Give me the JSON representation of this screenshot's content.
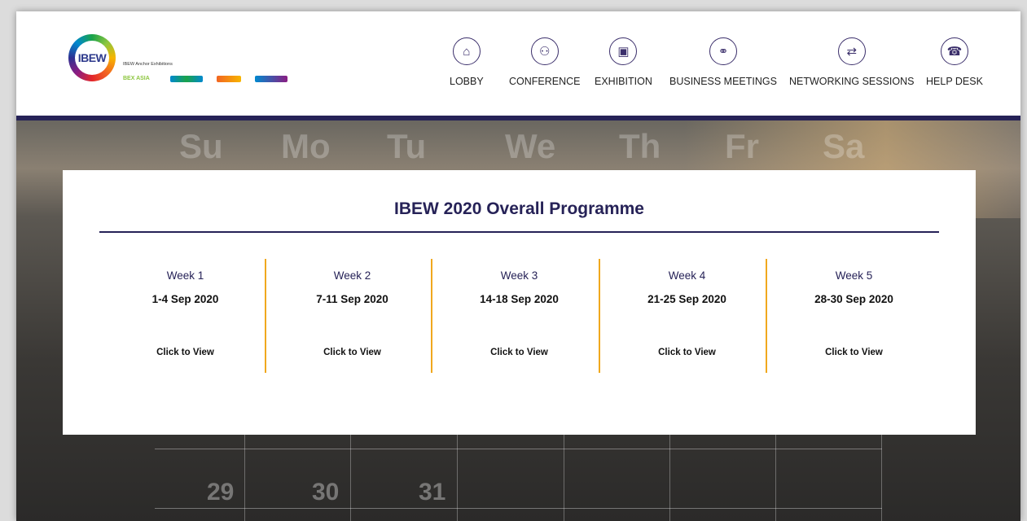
{
  "header": {
    "logo_text": "IBEW",
    "anchor_label": "IBEW Anchor Exhibitions",
    "partner_bex": "BEX ASIA"
  },
  "nav": [
    {
      "label": "LOBBY",
      "icon": "home-icon"
    },
    {
      "label": "CONFERENCE",
      "icon": "conference-icon"
    },
    {
      "label": "EXHIBITION",
      "icon": "exhibition-icon"
    },
    {
      "label": "BUSINESS MEETINGS",
      "icon": "business-meetings-icon"
    },
    {
      "label": "NETWORKING SESSIONS",
      "icon": "networking-icon"
    },
    {
      "label": "HELP DESK",
      "icon": "help-desk-icon"
    }
  ],
  "background": {
    "days": [
      "Su",
      "Mo",
      "Tu",
      "We",
      "Th",
      "Fr",
      "Sa"
    ],
    "dates": [
      "29",
      "30",
      "31"
    ]
  },
  "programme": {
    "title": "IBEW 2020 Overall Programme",
    "weeks": [
      {
        "name": "Week 1",
        "dates": "1-4 Sep 2020",
        "link": "Click to View"
      },
      {
        "name": "Week 2",
        "dates": "7-11 Sep 2020",
        "link": "Click to View"
      },
      {
        "name": "Week 3",
        "dates": "14-18 Sep 2020",
        "link": "Click to View"
      },
      {
        "name": "Week 4",
        "dates": "21-25 Sep 2020",
        "link": "Click to View"
      },
      {
        "name": "Week 5",
        "dates": "28-30 Sep 2020",
        "link": "Click to View"
      }
    ]
  },
  "colors": {
    "navy": "#262257",
    "accent": "#f0a81e"
  }
}
